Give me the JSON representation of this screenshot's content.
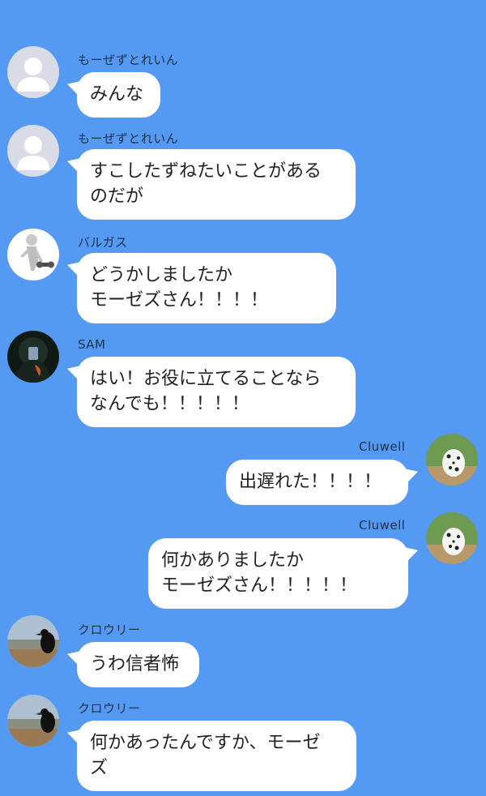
{
  "messages": [
    {
      "sender": "もーぜずとれいん",
      "lines": [
        "みんな"
      ],
      "avatar": "default-user-icon"
    },
    {
      "sender": "もーぜずとれいん",
      "lines": [
        "すこしたずねたいことがある",
        "のだが"
      ],
      "avatar": "default-user-icon"
    },
    {
      "sender": "バルガス",
      "lines": [
        "どうかしましたか",
        "モーゼズさん！！！！"
      ],
      "avatar": "dumbbell-figure-icon"
    },
    {
      "sender": "SAM",
      "lines": [
        "はい！お役に立てることなら",
        "なんでも！！！！！"
      ],
      "avatar": "hooded-figure-icon"
    },
    {
      "sender": "Cluwell",
      "lines": [
        "出遅れた！！！！"
      ],
      "avatar": "dalmatian-icon"
    },
    {
      "sender": "Cluwell",
      "lines": [
        "何かありましたか",
        "モーゼズさん！！！！！"
      ],
      "avatar": "dalmatian-icon"
    },
    {
      "sender": "クロウリー",
      "lines": [
        "うわ信者怖"
      ],
      "avatar": "crow-icon"
    },
    {
      "sender": "クロウリー",
      "lines": [
        "何かあったんですか、モーゼ",
        "ズ"
      ],
      "avatar": "crow-icon"
    }
  ],
  "colors": {
    "background": "#5499f2",
    "bubble": "#ffffff",
    "text": "#222222",
    "name": "#1f2f44"
  }
}
